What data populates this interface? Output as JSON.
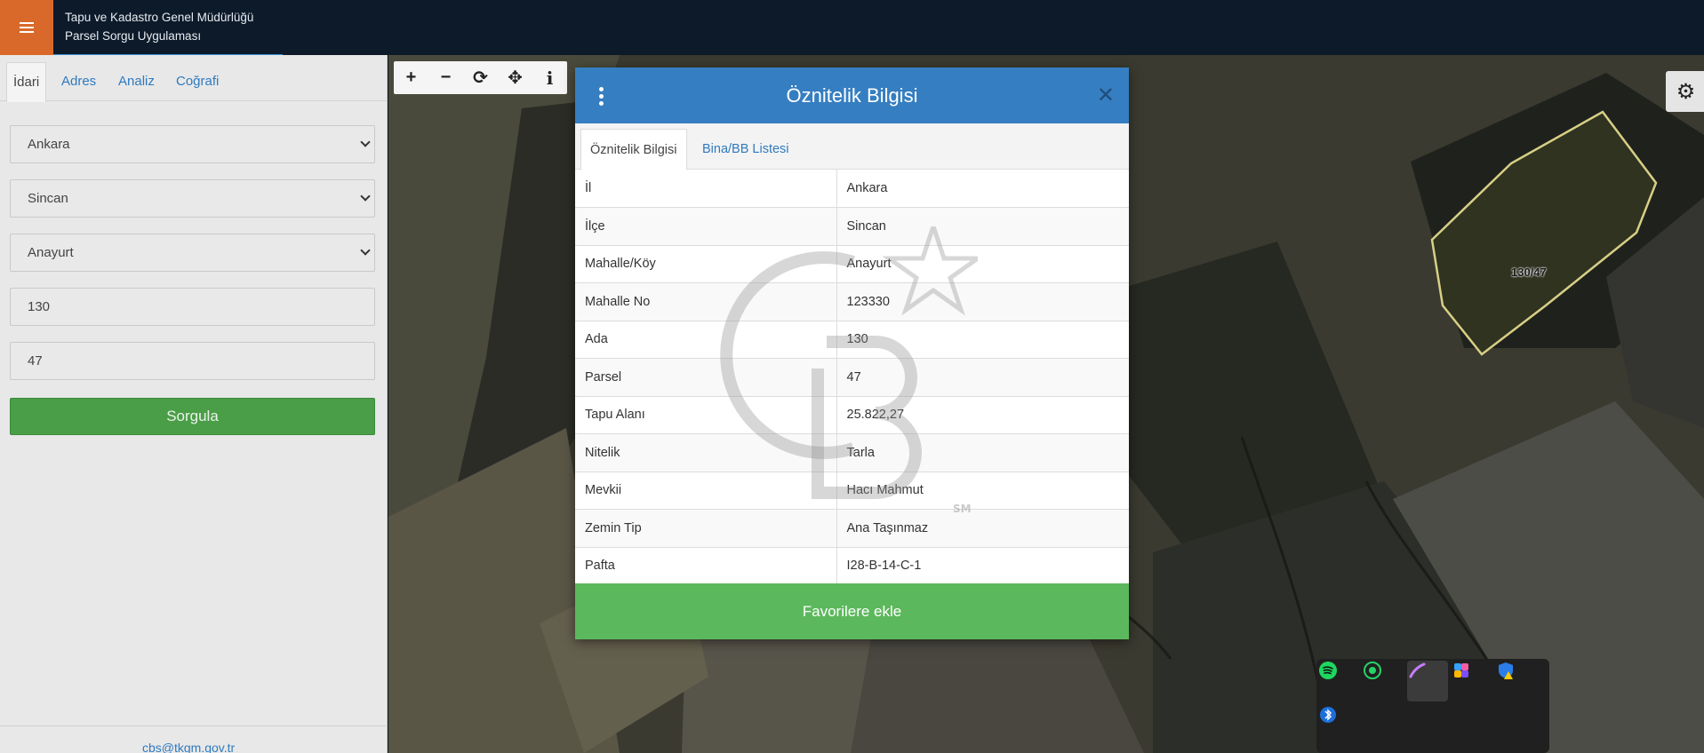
{
  "header": {
    "line1": "Tapu ve Kadastro Genel Müdürlüğü",
    "line2": "Parsel Sorgu Uygulaması"
  },
  "sidebar": {
    "tabs": [
      "İdari",
      "Adres",
      "Analiz",
      "Coğrafi"
    ],
    "il": "Ankara",
    "ilce": "Sincan",
    "mahalle": "Anayurt",
    "ada": "130",
    "parsel": "47",
    "submit_label": "Sorgula",
    "footer_email": "cbs@tkgm.gov.tr"
  },
  "map": {
    "tools": [
      "+",
      "−",
      "⟳",
      "✥",
      "i"
    ],
    "parcel_label": "130/47"
  },
  "modal": {
    "title": "Öznitelik Bilgisi",
    "tabs": [
      "Öznitelik Bilgisi",
      "Bina/BB Listesi"
    ],
    "rows": [
      {
        "key": "İl",
        "value": "Ankara"
      },
      {
        "key": "İlçe",
        "value": "Sincan"
      },
      {
        "key": "Mahalle/Köy",
        "value": "Anayurt"
      },
      {
        "key": "Mahalle No",
        "value": "123330"
      },
      {
        "key": "Ada",
        "value": "130"
      },
      {
        "key": "Parsel",
        "value": "47"
      },
      {
        "key": "Tapu Alanı",
        "value": "25.822,27"
      },
      {
        "key": "Nitelik",
        "value": "Tarla"
      },
      {
        "key": "Mevkii",
        "value": "Hacı Mahmut"
      },
      {
        "key": "Zemin Tip",
        "value": "Ana Taşınmaz"
      },
      {
        "key": "Pafta",
        "value": "I28-B-14-C-1"
      }
    ],
    "favorite_label": "Favorilere ekle"
  },
  "watermark": {
    "mark": "SM"
  },
  "colors": {
    "header_bg": "#0c1a2a",
    "menu_orange": "#d9692a",
    "modal_blue": "#357ec1",
    "submit_green": "#4b9e48",
    "favorite_green": "#5cb85c",
    "link_blue": "#2f7abf"
  }
}
